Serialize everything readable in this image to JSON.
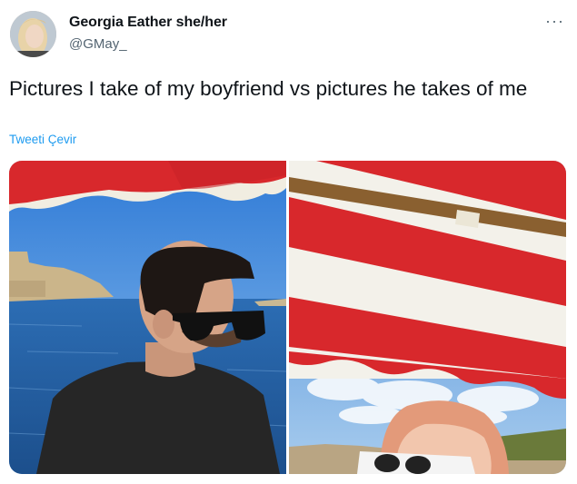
{
  "author": {
    "display_name": "Georgia Eather she/her",
    "handle": "@GMay_"
  },
  "more_label": "···",
  "tweet": {
    "text": "Pictures I take of my boyfriend vs pictures he takes of me",
    "translate_label": "Tweeti Çevir"
  },
  "media": {
    "count": 2,
    "colors": {
      "awning_red": "#d8282c",
      "awning_white": "#f3f1ea",
      "sky": "#4a8ee0",
      "sea": "#2f6cb0",
      "shirt": "#262626"
    }
  }
}
